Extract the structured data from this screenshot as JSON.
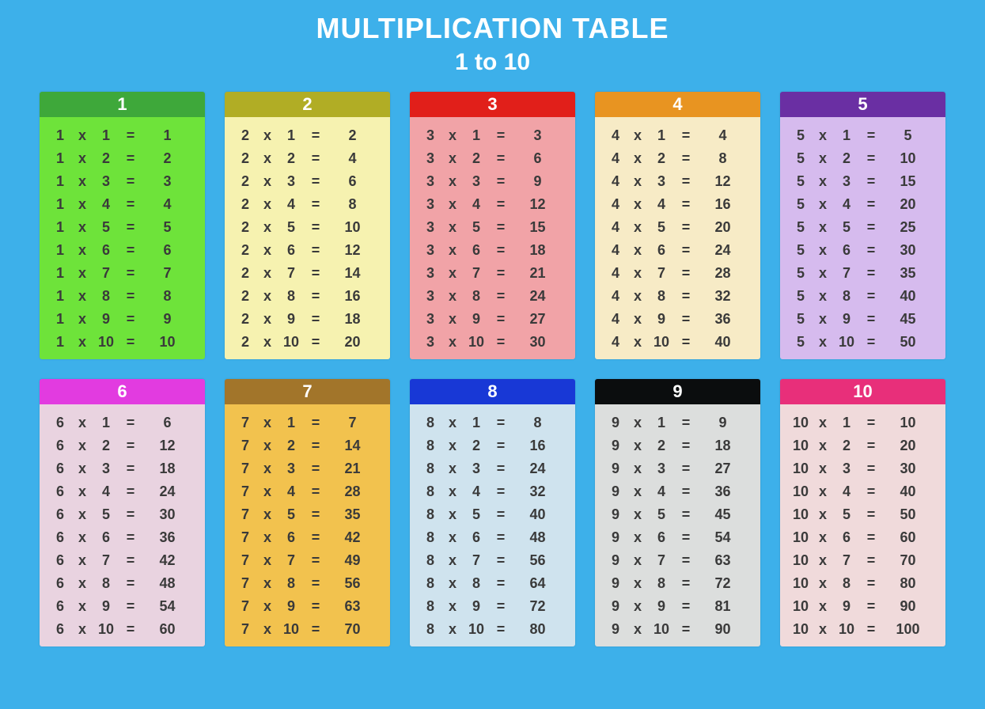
{
  "title": "MULTIPLICATION TABLE",
  "subtitle": "1 to 10",
  "symbols": {
    "times": "x",
    "equals": "="
  },
  "multipliers": [
    1,
    2,
    3,
    4,
    5,
    6,
    7,
    8,
    9,
    10
  ],
  "cards": [
    {
      "n": 1,
      "head_bg": "#3ea83a",
      "body_bg": "#6ee33a",
      "products": [
        1,
        2,
        3,
        4,
        5,
        6,
        7,
        8,
        9,
        10
      ]
    },
    {
      "n": 2,
      "head_bg": "#b1ad25",
      "body_bg": "#f6f2b0",
      "products": [
        2,
        4,
        6,
        8,
        10,
        12,
        14,
        16,
        18,
        20
      ]
    },
    {
      "n": 3,
      "head_bg": "#e11f1a",
      "body_bg": "#f1a3a7",
      "products": [
        3,
        6,
        9,
        12,
        15,
        18,
        21,
        24,
        27,
        30
      ]
    },
    {
      "n": 4,
      "head_bg": "#e89421",
      "body_bg": "#f7ebc6",
      "products": [
        4,
        8,
        12,
        16,
        20,
        24,
        28,
        32,
        36,
        40
      ]
    },
    {
      "n": 5,
      "head_bg": "#6a2fa3",
      "body_bg": "#d6bbee",
      "products": [
        5,
        10,
        15,
        20,
        25,
        30,
        35,
        40,
        45,
        50
      ]
    },
    {
      "n": 6,
      "head_bg": "#e23be0",
      "body_bg": "#e9d3e0",
      "products": [
        6,
        12,
        18,
        24,
        30,
        36,
        42,
        48,
        54,
        60
      ]
    },
    {
      "n": 7,
      "head_bg": "#a2752a",
      "body_bg": "#f2c24e",
      "products": [
        7,
        14,
        21,
        28,
        35,
        42,
        49,
        56,
        63,
        70
      ]
    },
    {
      "n": 8,
      "head_bg": "#1838d6",
      "body_bg": "#cfe3ee",
      "products": [
        8,
        16,
        24,
        32,
        40,
        48,
        56,
        64,
        72,
        80
      ]
    },
    {
      "n": 9,
      "head_bg": "#0b0d0e",
      "body_bg": "#dcdedd",
      "products": [
        9,
        18,
        27,
        36,
        45,
        54,
        63,
        72,
        81,
        90
      ]
    },
    {
      "n": 10,
      "head_bg": "#e82f7a",
      "body_bg": "#f0dadb",
      "products": [
        10,
        20,
        30,
        40,
        50,
        60,
        70,
        80,
        90,
        100
      ]
    }
  ]
}
